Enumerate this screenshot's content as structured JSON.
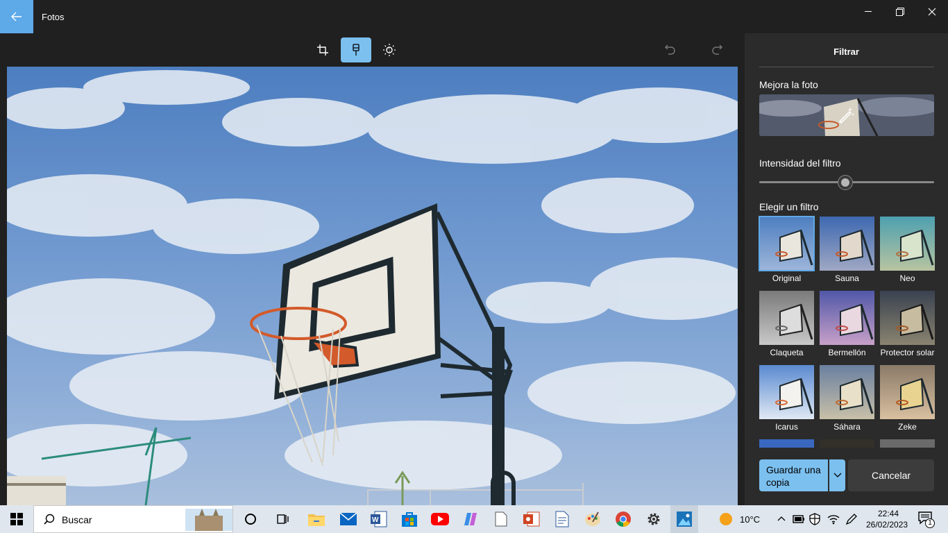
{
  "window": {
    "title": "Fotos"
  },
  "panel": {
    "title": "Filtrar",
    "enhance_label": "Mejora la foto",
    "intensity_label": "Intensidad del filtro",
    "intensity_value": 0.5,
    "choose_label": "Elegir un filtro",
    "filters": [
      {
        "name": "Original",
        "selected": true
      },
      {
        "name": "Sauna"
      },
      {
        "name": "Neo"
      },
      {
        "name": "Claqueta"
      },
      {
        "name": "Bermellón"
      },
      {
        "name": "Protector solar"
      },
      {
        "name": "Icarus"
      },
      {
        "name": "Sáhara"
      },
      {
        "name": "Zeke"
      }
    ],
    "save_label": "Guardar una copia",
    "cancel_label": "Cancelar"
  },
  "taskbar": {
    "search_placeholder": "Buscar",
    "weather": "10°C",
    "time": "22:44",
    "date": "26/02/2023",
    "notification_count": "1"
  },
  "icons": [
    "back-arrow-icon",
    "minimize-icon",
    "restore-icon",
    "close-icon",
    "crop-icon",
    "filter-brush-icon",
    "brightness-icon",
    "undo-icon",
    "redo-icon",
    "magic-wand-icon",
    "chevron-down-icon",
    "windows-start-icon",
    "search-icon",
    "cortana-icon",
    "task-view-icon",
    "file-explorer-icon",
    "mail-icon",
    "word-icon",
    "store-icon",
    "youtube-icon",
    "copilot-icon",
    "notepad-icon",
    "powerpoint-icon",
    "document-icon",
    "paint-icon",
    "chrome-icon",
    "settings-icon",
    "photos-icon",
    "weather-sun-icon",
    "chevron-up-icon",
    "battery-icon",
    "shield-icon",
    "wifi-icon",
    "pen-icon",
    "notification-icon"
  ],
  "colors": {
    "accent": "#7cc0ef",
    "titlebar": "#202020",
    "panel": "#2b2b2b",
    "taskbar": "#dfe6ee"
  }
}
